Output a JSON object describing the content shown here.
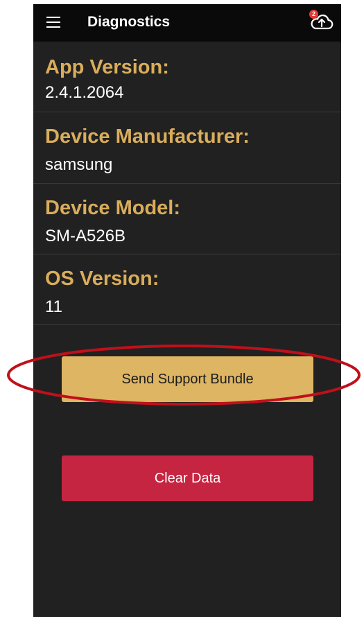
{
  "header": {
    "title": "Diagnostics",
    "menu_icon": "hamburger-menu-icon",
    "upload_icon": "cloud-upload-icon",
    "upload_badge_count": "2"
  },
  "info": {
    "app_version": {
      "label": "App Version:",
      "value": "2.4.1.2064"
    },
    "device_manufacturer": {
      "label": "Device Manufacturer:",
      "value": "samsung"
    },
    "device_model": {
      "label": "Device Model:",
      "value": "SM-A526B"
    },
    "os_version": {
      "label": "OS Version:",
      "value": "11"
    }
  },
  "actions": {
    "send_support_bundle": "Send Support Bundle",
    "clear_data": "Clear Data"
  },
  "colors": {
    "background": "#212121",
    "topbar": "#0a0a0a",
    "label_gold": "#d9ad5b",
    "support_button": "#ddb563",
    "clear_button": "#c62541",
    "annotation_red": "#c0101a",
    "badge_red": "#e53935"
  }
}
